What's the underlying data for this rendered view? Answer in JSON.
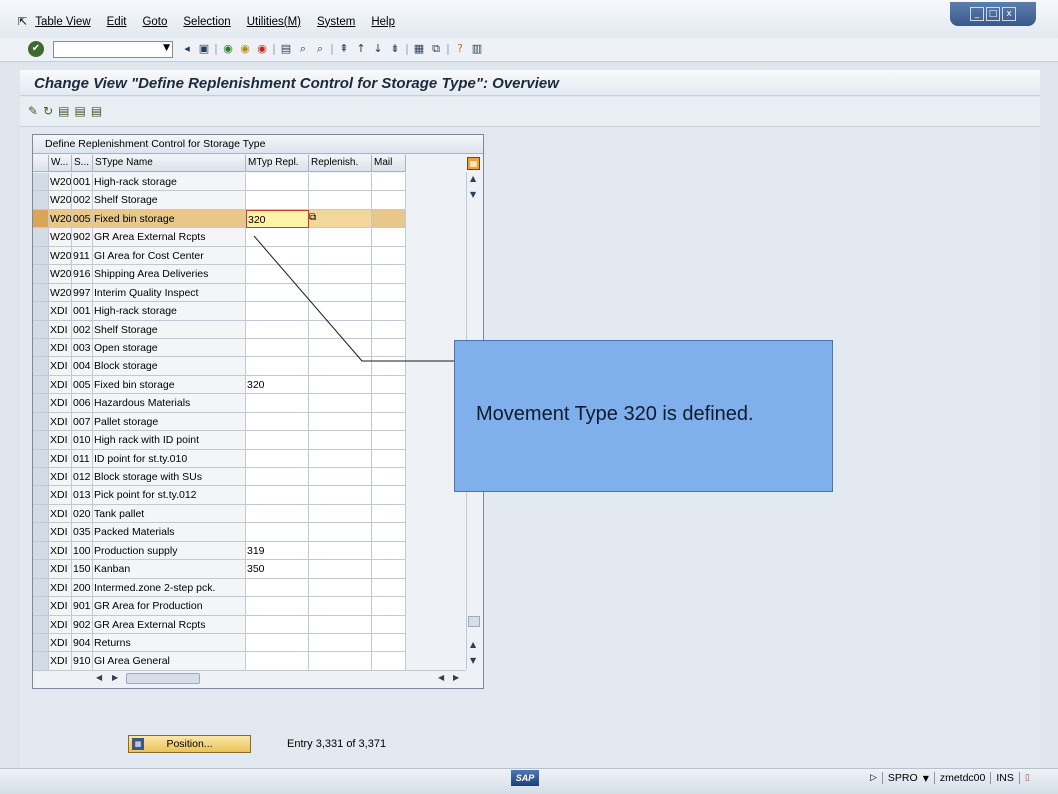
{
  "menu": {
    "items": [
      "Table View",
      "Edit",
      "Goto",
      "Selection",
      "Utilities(M)",
      "System",
      "Help"
    ]
  },
  "window_controls": [
    "_",
    "□",
    "x"
  ],
  "toolbar": {
    "command_field_value": "",
    "icons": [
      "enter-icon",
      "back-icon",
      "save-icon",
      "back-nav-icon",
      "exit-icon",
      "cancel-icon",
      "print-icon",
      "find-icon",
      "find-next-icon",
      "first-page-icon",
      "prev-page-icon",
      "next-page-icon",
      "last-page-icon",
      "create-session-icon",
      "shortcut-icon",
      "help-icon",
      "layout-icon"
    ]
  },
  "title": "Change View \"Define Replenishment Control for Storage Type\": Overview",
  "table": {
    "title": "Define Replenishment Control for Storage Type",
    "headers": [
      "W...",
      "S...",
      "SType Name",
      "MTyp Repl.",
      "Replenish.",
      "Mail"
    ],
    "rows": [
      {
        "w": "W20",
        "s": "001",
        "name": "High-rack storage",
        "mtyp": "",
        "repl": "",
        "mail": ""
      },
      {
        "w": "W20",
        "s": "002",
        "name": "Shelf Storage",
        "mtyp": "",
        "repl": "",
        "mail": ""
      },
      {
        "w": "W20",
        "s": "005",
        "name": "Fixed bin storage",
        "mtyp": "320",
        "repl": "",
        "mail": "",
        "active": true
      },
      {
        "w": "W20",
        "s": "902",
        "name": "GR Area External Rcpts",
        "mtyp": "",
        "repl": "",
        "mail": ""
      },
      {
        "w": "W20",
        "s": "911",
        "name": "GI Area for Cost Center",
        "mtyp": "",
        "repl": "",
        "mail": ""
      },
      {
        "w": "W20",
        "s": "916",
        "name": "Shipping Area Deliveries",
        "mtyp": "",
        "repl": "",
        "mail": ""
      },
      {
        "w": "W20",
        "s": "997",
        "name": "Interim Quality Inspect",
        "mtyp": "",
        "repl": "",
        "mail": ""
      },
      {
        "w": "XDI",
        "s": "001",
        "name": "High-rack storage",
        "mtyp": "",
        "repl": "",
        "mail": ""
      },
      {
        "w": "XDI",
        "s": "002",
        "name": "Shelf Storage",
        "mtyp": "",
        "repl": "",
        "mail": ""
      },
      {
        "w": "XDI",
        "s": "003",
        "name": "Open storage",
        "mtyp": "",
        "repl": "",
        "mail": ""
      },
      {
        "w": "XDI",
        "s": "004",
        "name": "Block storage",
        "mtyp": "",
        "repl": "",
        "mail": ""
      },
      {
        "w": "XDI",
        "s": "005",
        "name": "Fixed bin storage",
        "mtyp": "320",
        "repl": "",
        "mail": ""
      },
      {
        "w": "XDI",
        "s": "006",
        "name": "Hazardous Materials",
        "mtyp": "",
        "repl": "",
        "mail": ""
      },
      {
        "w": "XDI",
        "s": "007",
        "name": "Pallet storage",
        "mtyp": "",
        "repl": "",
        "mail": ""
      },
      {
        "w": "XDI",
        "s": "010",
        "name": "High rack with ID point",
        "mtyp": "",
        "repl": "",
        "mail": ""
      },
      {
        "w": "XDI",
        "s": "011",
        "name": "ID point for st.ty.010",
        "mtyp": "",
        "repl": "",
        "mail": ""
      },
      {
        "w": "XDI",
        "s": "012",
        "name": "Block storage with SUs",
        "mtyp": "",
        "repl": "",
        "mail": ""
      },
      {
        "w": "XDI",
        "s": "013",
        "name": "Pick point for st.ty.012",
        "mtyp": "",
        "repl": "",
        "mail": ""
      },
      {
        "w": "XDI",
        "s": "020",
        "name": "Tank pallet",
        "mtyp": "",
        "repl": "",
        "mail": ""
      },
      {
        "w": "XDI",
        "s": "035",
        "name": "Packed Materials",
        "mtyp": "",
        "repl": "",
        "mail": ""
      },
      {
        "w": "XDI",
        "s": "100",
        "name": "Production supply",
        "mtyp": "319",
        "repl": "",
        "mail": ""
      },
      {
        "w": "XDI",
        "s": "150",
        "name": "Kanban",
        "mtyp": "350",
        "repl": "",
        "mail": ""
      },
      {
        "w": "XDI",
        "s": "200",
        "name": "Intermed.zone 2-step pck.",
        "mtyp": "",
        "repl": "",
        "mail": ""
      },
      {
        "w": "XDI",
        "s": "901",
        "name": "GR Area for Production",
        "mtyp": "",
        "repl": "",
        "mail": ""
      },
      {
        "w": "XDI",
        "s": "902",
        "name": "GR Area External Rcpts",
        "mtyp": "",
        "repl": "",
        "mail": ""
      },
      {
        "w": "XDI",
        "s": "904",
        "name": "Returns",
        "mtyp": "",
        "repl": "",
        "mail": ""
      },
      {
        "w": "XDI",
        "s": "910",
        "name": "GI Area General",
        "mtyp": "",
        "repl": "",
        "mail": ""
      }
    ]
  },
  "callout": {
    "text": "Movement Type 320 is defined."
  },
  "footer": {
    "position_button": "Position...",
    "entry_text": "Entry 3,331 of 3,371"
  },
  "status": {
    "logo": "SAP",
    "transaction": "SPRO",
    "server": "zmetdc00",
    "mode": "INS"
  }
}
